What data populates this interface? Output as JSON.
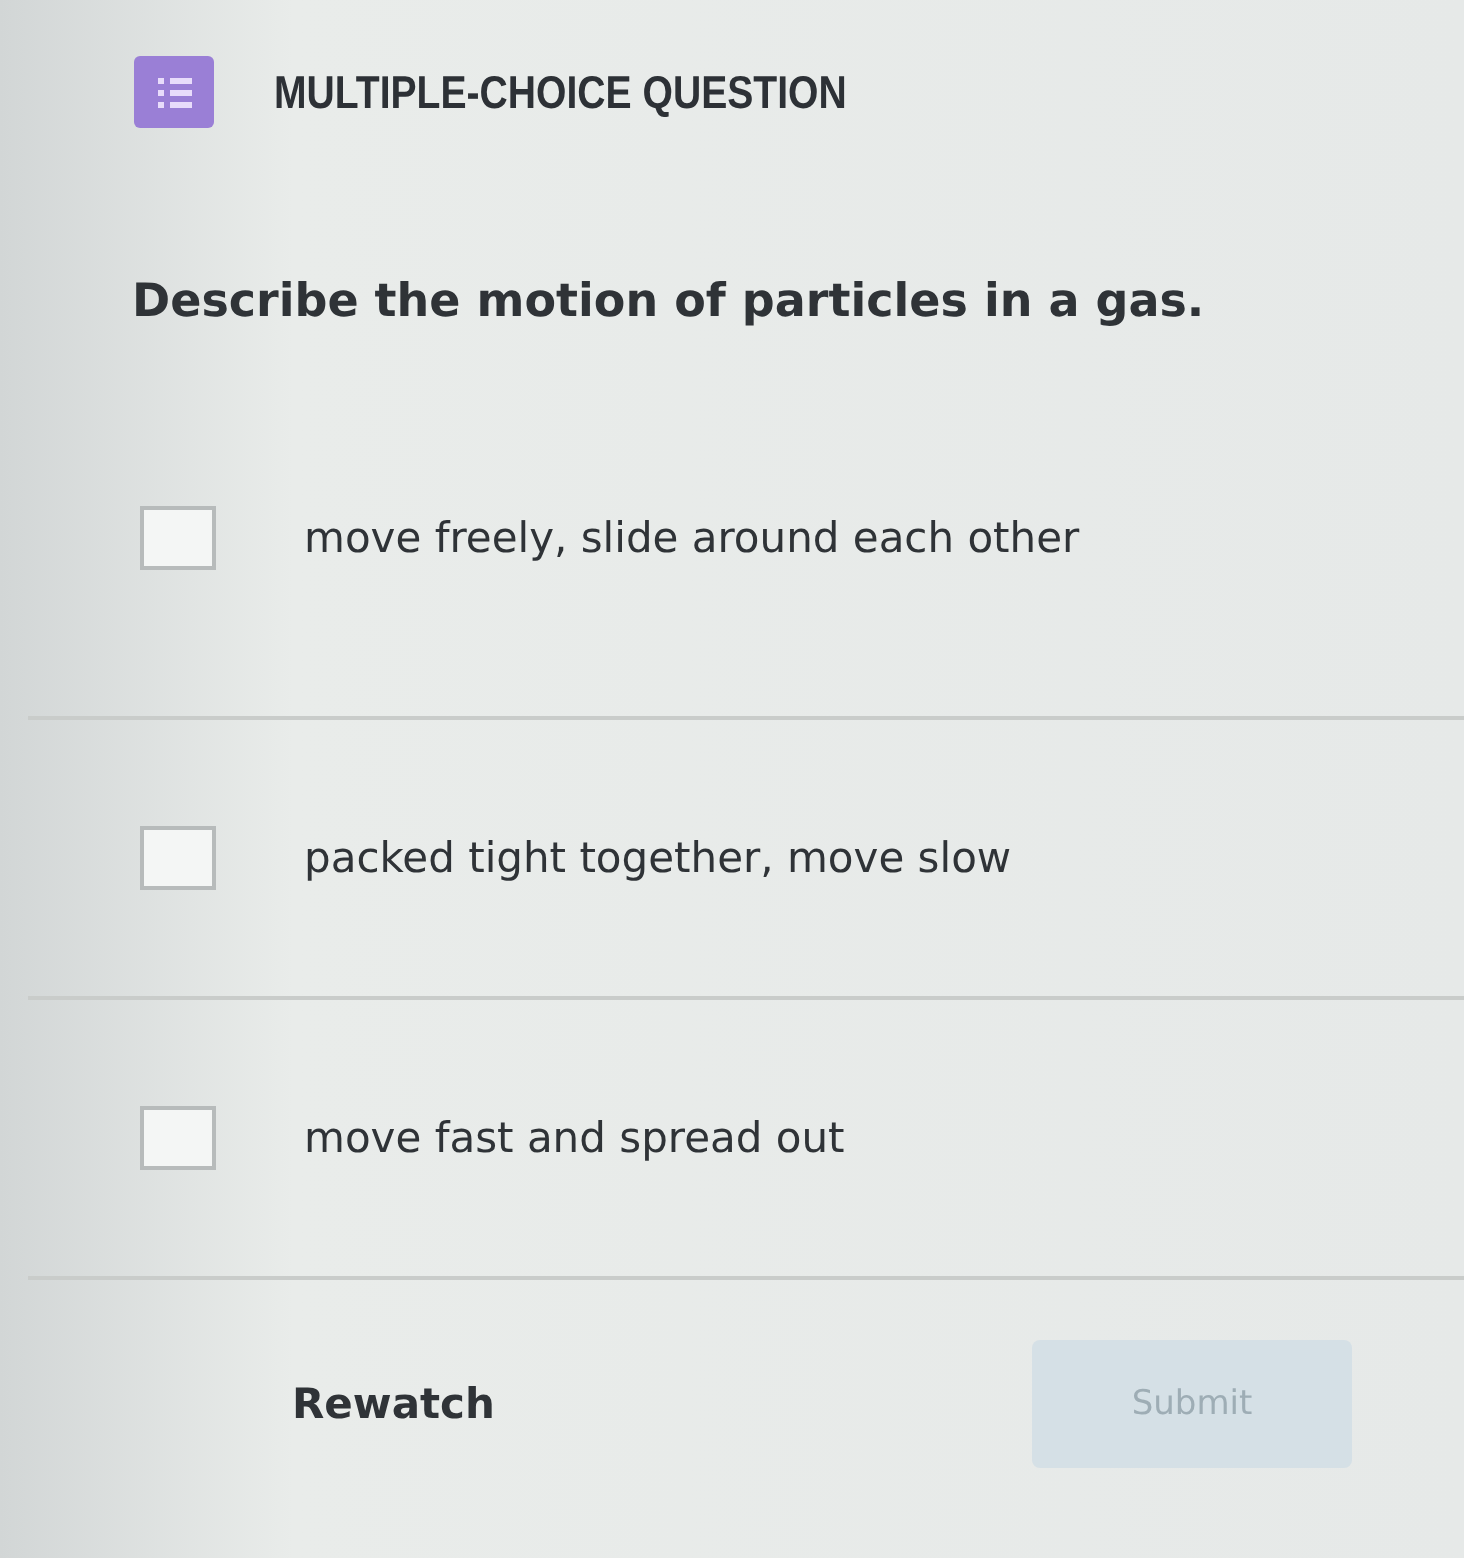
{
  "header": {
    "title": "MULTIPLE-CHOICE QUESTION"
  },
  "question": "Describe the motion of particles in a gas.",
  "options": [
    {
      "text": "move freely, slide around each other",
      "checked": false
    },
    {
      "text": "packed tight together, move slow",
      "checked": false
    },
    {
      "text": "move fast and spread out",
      "checked": false
    }
  ],
  "actions": {
    "rewatch": "Rewatch",
    "submit": {
      "label": "Submit",
      "disabled": true
    }
  }
}
